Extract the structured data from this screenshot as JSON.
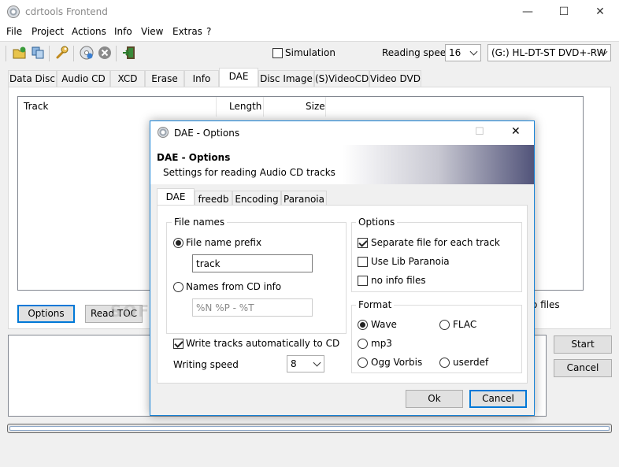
{
  "window": {
    "title": "cdrtools Frontend",
    "controls": {
      "minimize": "—",
      "maximize": "☐",
      "close": "✕"
    }
  },
  "menu": [
    "File",
    "Project",
    "Actions",
    "Info",
    "View",
    "Extras",
    "?"
  ],
  "toolbar": {
    "icons": [
      "open-project-icon",
      "copy-icon",
      "wrench-icon",
      "disc-burn-icon",
      "stop-icon",
      "exit-icon"
    ],
    "simulation_label": "Simulation",
    "simulation_checked": false,
    "reading_speed_label": "Reading speed",
    "reading_speed_value": "16",
    "drive_value": "(G:) HL-DT-ST DVD+-RW"
  },
  "tabs": [
    "Data Disc",
    "Audio CD",
    "XCD",
    "Erase",
    "Info",
    "DAE",
    "Disc Image",
    "(S)VideoCD",
    "Video DVD"
  ],
  "active_tab": "DAE",
  "track_list": {
    "columns": [
      "Track",
      "Length",
      "Size"
    ]
  },
  "main_buttons": {
    "options": "Options",
    "read_toc": "Read TOC",
    "start": "Start",
    "cancel": "Cancel"
  },
  "partial_text": "o files",
  "watermark": "SOFTPEDIA",
  "dialog": {
    "title": "DAE - Options",
    "header_title": "DAE - Options",
    "header_subtitle": "Settings for reading Audio CD tracks",
    "tabs": [
      "DAE",
      "freedb",
      "Encoding",
      "Paranoia"
    ],
    "active_tab": "DAE",
    "file_names": {
      "label": "File names",
      "prefix_label": "File name prefix",
      "prefix_selected": true,
      "prefix_value": "track",
      "cd_info_label": "Names from CD info",
      "cd_info_value": "%N %P - %T"
    },
    "options": {
      "label": "Options",
      "separate_file": "Separate file for each track",
      "separate_file_checked": true,
      "lib_paranoia": "Use Lib Paranoia",
      "lib_paranoia_checked": false,
      "no_info": "no info files",
      "no_info_checked": false
    },
    "format": {
      "label": "Format",
      "items": [
        "Wave",
        "FLAC",
        "mp3",
        "Ogg Vorbis",
        "userdef"
      ],
      "selected": "Wave"
    },
    "write_tracks_label": "Write tracks automatically to CD",
    "write_tracks_checked": true,
    "writing_speed_label": "Writing speed",
    "writing_speed_value": "8",
    "ok": "Ok",
    "cancel": "Cancel"
  }
}
